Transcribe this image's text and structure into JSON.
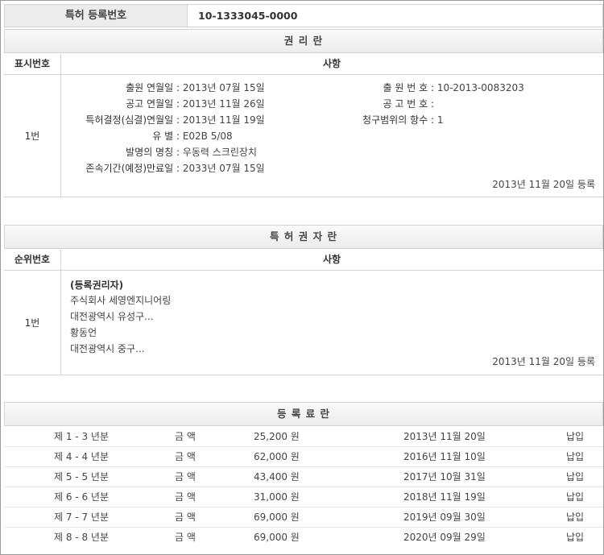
{
  "header": {
    "label": "특허 등록번호",
    "value": "10-1333045-0000"
  },
  "rights": {
    "title": "권 리 란",
    "col_no": "표시번호",
    "col_item": "사항",
    "row_no": "1번",
    "left": [
      {
        "key": "출원 연월일 :",
        "value": "2013년 07월 15일"
      },
      {
        "key": "공고 연월일 :",
        "value": "2013년 11월 26일"
      },
      {
        "key": "특허결정(심결)연월일 :",
        "value": "2013년 11월 19일"
      },
      {
        "key": "유 별 :",
        "value": "E02B 5/08"
      },
      {
        "key": "발명의 명칭 :",
        "value": "우동력 스크린장치"
      },
      {
        "key": "존속기간(예정)만료일 :",
        "value": "2033년 07월 15일"
      }
    ],
    "right": [
      {
        "key": "출 원 번 호 :",
        "value": "10-2013-0083203"
      },
      {
        "key": "공 고 번 호 :",
        "value": ""
      },
      {
        "key": "청구범위의 항수 :",
        "value": "1"
      }
    ],
    "stamp": "2013년 11월 20일 등록"
  },
  "holders": {
    "title": "특 허 권 자 란",
    "col_no": "순위번호",
    "col_item": "사항",
    "row_no": "1번",
    "heading": "(등록권리자)",
    "lines": [
      "주식회사 세영엔지니어링",
      "대전광역시 유성구...",
      "황동언",
      "대전광역시 중구..."
    ],
    "stamp": "2013년 11월 20일 등록"
  },
  "fees": {
    "title": "등 록 료 란",
    "rows": [
      {
        "period": "제 1 - 3 년분",
        "label": "금 액",
        "amount": "25,200 원",
        "date": "2013년 11월 20일",
        "status": "납입"
      },
      {
        "period": "제 4 - 4 년분",
        "label": "금 액",
        "amount": "62,000 원",
        "date": "2016년 11월 10일",
        "status": "납입"
      },
      {
        "period": "제 5 - 5 년분",
        "label": "금 액",
        "amount": "43,400 원",
        "date": "2017년 10월 31일",
        "status": "납입"
      },
      {
        "period": "제 6 - 6 년분",
        "label": "금 액",
        "amount": "31,000 원",
        "date": "2018년 11월 19일",
        "status": "납입"
      },
      {
        "period": "제 7 - 7 년분",
        "label": "금 액",
        "amount": "69,000 원",
        "date": "2019년 09월 30일",
        "status": "납입"
      },
      {
        "period": "제 8 - 8 년분",
        "label": "금 액",
        "amount": "69,000 원",
        "date": "2020년 09월 29일",
        "status": "납입"
      }
    ]
  }
}
